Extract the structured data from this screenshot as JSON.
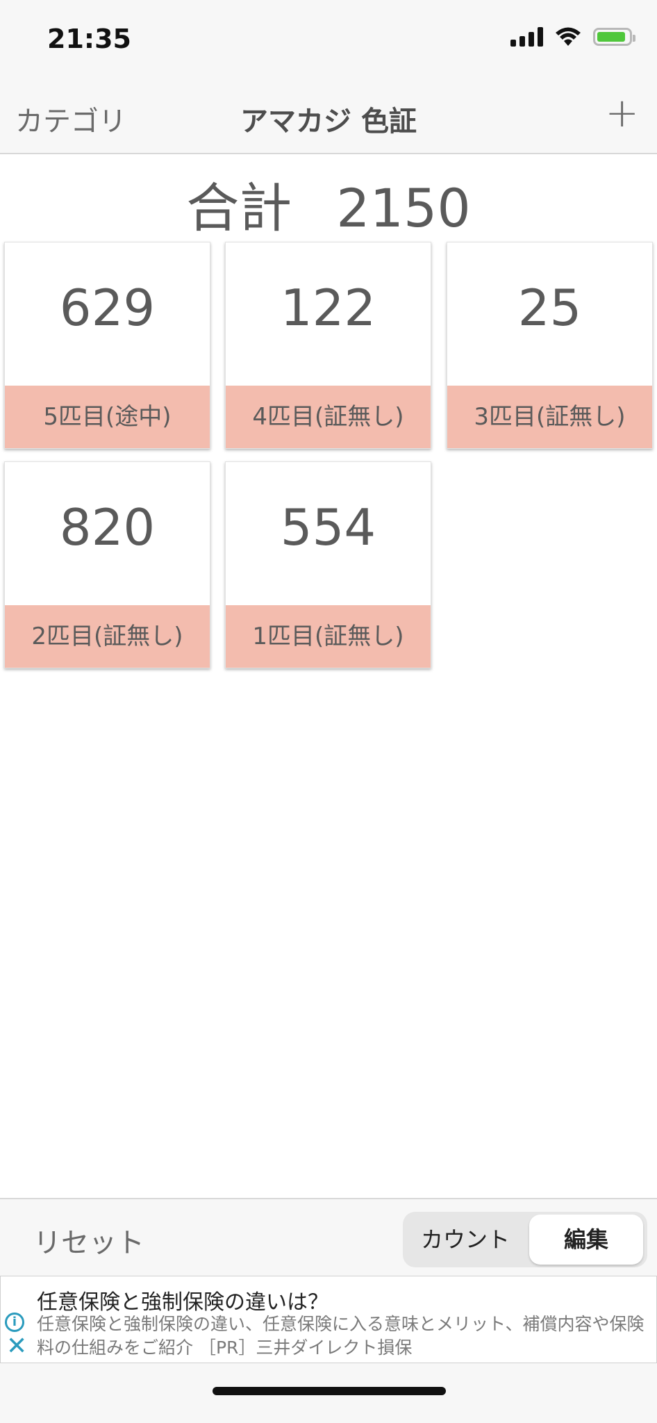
{
  "status_bar": {
    "time": "21:35"
  },
  "nav": {
    "back_label": "カテゴリ",
    "title": "アマカジ 色証",
    "add_label": "+"
  },
  "total": {
    "label": "合計",
    "value": "2150"
  },
  "cards": [
    {
      "count": "629",
      "name": "5匹目(途中)"
    },
    {
      "count": "122",
      "name": "4匹目(証無し)"
    },
    {
      "count": "25",
      "name": "3匹目(証無し)"
    },
    {
      "count": "820",
      "name": "2匹目(証無し)"
    },
    {
      "count": "554",
      "name": "1匹目(証無し)"
    }
  ],
  "toolbar": {
    "reset_label": "リセット",
    "segment_count": "カウント",
    "segment_edit": "編集",
    "selected": "編集"
  },
  "ad": {
    "headline": "任意保険と強制保険の違いは？",
    "body": "任意保険と強制保険の違い、任意保険に入る意味とメリット、補償内容や保険料の仕組みをご紹介 ［PR］三井ダイレクト損保"
  },
  "colors": {
    "card_label_bg": "#f3bcae",
    "bar_bg": "#f7f7f7",
    "ad_icon": "#2a9bbd",
    "battery": "#4fc73b"
  }
}
